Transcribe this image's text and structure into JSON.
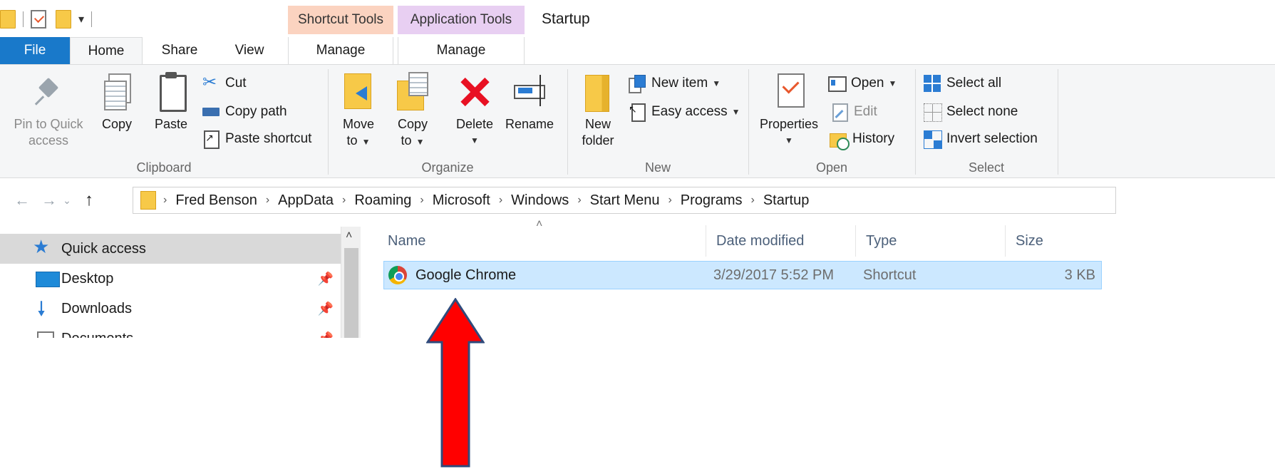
{
  "window": {
    "title": "Startup",
    "context_tabs": {
      "shortcut_tools": "Shortcut Tools",
      "application_tools": "Application Tools"
    }
  },
  "ribbon_tabs": {
    "file": "File",
    "home": "Home",
    "share": "Share",
    "view": "View",
    "manage_shortcut": "Manage",
    "manage_application": "Manage"
  },
  "clipboard": {
    "label": "Clipboard",
    "pin_line1": "Pin to Quick",
    "pin_line2": "access",
    "copy": "Copy",
    "paste": "Paste",
    "cut": "Cut",
    "copy_path": "Copy path",
    "paste_shortcut": "Paste shortcut"
  },
  "organize": {
    "label": "Organize",
    "move_to_line1": "Move",
    "move_to_line2": "to",
    "copy_to_line1": "Copy",
    "copy_to_line2": "to",
    "delete": "Delete",
    "rename": "Rename"
  },
  "new_group": {
    "label": "New",
    "new_folder_line1": "New",
    "new_folder_line2": "folder",
    "new_item": "New item",
    "easy_access": "Easy access"
  },
  "open_group": {
    "label": "Open",
    "properties": "Properties",
    "open": "Open",
    "edit": "Edit",
    "history": "History"
  },
  "select_group": {
    "label": "Select",
    "select_all": "Select all",
    "select_none": "Select none",
    "invert_selection": "Invert selection"
  },
  "address": {
    "crumbs": [
      "Fred Benson",
      "AppData",
      "Roaming",
      "Microsoft",
      "Windows",
      "Start Menu",
      "Programs",
      "Startup"
    ]
  },
  "nav_pane": {
    "items": [
      {
        "label": "Quick access",
        "icon": "star-icon"
      },
      {
        "label": "Desktop",
        "icon": "desktop-icon"
      },
      {
        "label": "Downloads",
        "icon": "download-icon"
      },
      {
        "label": "Documents",
        "icon": "document-icon"
      }
    ]
  },
  "file_list": {
    "columns": {
      "name": "Name",
      "date": "Date modified",
      "type": "Type",
      "size": "Size"
    },
    "rows": [
      {
        "name": "Google Chrome",
        "date": "3/29/2017 5:52 PM",
        "type": "Shortcut",
        "size": "3 KB",
        "icon": "chrome-icon"
      }
    ]
  },
  "colors": {
    "file_tab": "#1979ca",
    "shortcut_tools": "#fbd3c0",
    "application_tools": "#e8cff2",
    "selected_row": "#cce8ff",
    "annotation_arrow": "#ff0000"
  }
}
